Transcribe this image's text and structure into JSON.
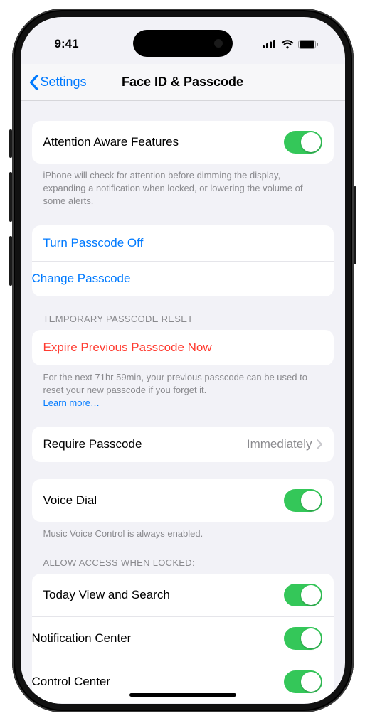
{
  "status": {
    "time": "9:41"
  },
  "nav": {
    "back_label": "Settings",
    "title": "Face ID & Passcode"
  },
  "attention": {
    "label": "Attention Aware Features",
    "footer": "iPhone will check for attention before dimming the display, expanding a notification when locked, or lowering the volume of some alerts."
  },
  "passcode": {
    "turn_off": "Turn Passcode Off",
    "change": "Change Passcode"
  },
  "temp_reset": {
    "header": "TEMPORARY PASSCODE RESET",
    "expire": "Expire Previous Passcode Now",
    "footer": "For the next 71hr 59min, your previous passcode can be used to reset your new passcode if you forget it.",
    "learn_more": "Learn more…"
  },
  "require": {
    "label": "Require Passcode",
    "value": "Immediately"
  },
  "voice": {
    "label": "Voice Dial",
    "footer": "Music Voice Control is always enabled."
  },
  "allow_header": "ALLOW ACCESS WHEN LOCKED:",
  "allow": [
    {
      "label": "Today View and Search"
    },
    {
      "label": "Notification Center"
    },
    {
      "label": "Control Center"
    }
  ]
}
